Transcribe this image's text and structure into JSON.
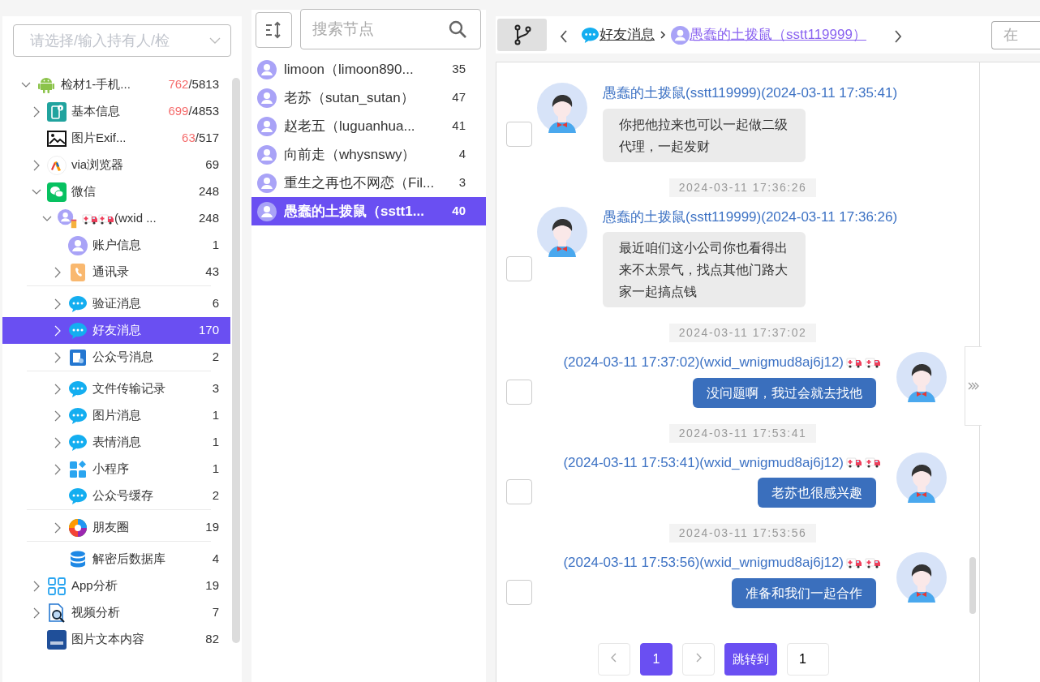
{
  "holder_select": {
    "placeholder": "请选择/输入持有人/检"
  },
  "tree": [
    {
      "label": "检材1-手机...",
      "count_red": "762",
      "count": "/5813",
      "expanded": true,
      "selected": false,
      "children": [
        {
          "label": "基本信息",
          "count_red": "699",
          "count": "/4853",
          "expanded": false,
          "selected": false
        },
        {
          "label": "图片Exif...",
          "count_red": "63",
          "count": "/517",
          "selected": false
        },
        {
          "label": "via浏览器",
          "count": "69",
          "expanded": false,
          "selected": false
        },
        {
          "label": "微信",
          "count": "248",
          "expanded": true,
          "selected": false,
          "children": [
            {
              "label": "(wxid ...",
              "count": "248",
              "expanded": true,
              "selected": false,
              "children": [
                {
                  "label": "账户信息",
                  "count": "1",
                  "selected": false,
                  "separated": false
                },
                {
                  "label": "通讯录",
                  "count": "43",
                  "expanded": false,
                  "selected": false,
                  "separated": false
                },
                {
                  "label": "验证消息",
                  "count": "6",
                  "expanded": false,
                  "selected": false,
                  "separated": true
                },
                {
                  "label": "好友消息",
                  "count": "170",
                  "expanded": false,
                  "selected": true,
                  "separated": false
                },
                {
                  "label": "公众号消息",
                  "count": "2",
                  "expanded": false,
                  "selected": false,
                  "separated": false
                },
                {
                  "label": "文件传输记录",
                  "count": "3",
                  "expanded": false,
                  "selected": false,
                  "separated": true
                },
                {
                  "label": "图片消息",
                  "count": "1",
                  "expanded": false,
                  "selected": false,
                  "separated": false
                },
                {
                  "label": "表情消息",
                  "count": "1",
                  "expanded": false,
                  "selected": false,
                  "separated": false
                },
                {
                  "label": "小程序",
                  "count": "1",
                  "expanded": false,
                  "selected": false,
                  "separated": false
                },
                {
                  "label": "公众号缓存",
                  "count": "2",
                  "selected": false,
                  "separated": false
                },
                {
                  "label": "朋友圈",
                  "count": "19",
                  "expanded": false,
                  "selected": false,
                  "separated": true
                },
                {
                  "label": "解密后数据库",
                  "count": "4",
                  "selected": false,
                  "separated": true
                }
              ]
            }
          ]
        },
        {
          "label": "App分析",
          "count": "19",
          "expanded": false,
          "selected": false
        },
        {
          "label": "视频分析",
          "count": "7",
          "expanded": false,
          "selected": false
        },
        {
          "label": "图片文本内容",
          "count": "82",
          "selected": false
        }
      ]
    }
  ],
  "node_search": {
    "placeholder": "搜索节点"
  },
  "contacts": [
    {
      "name": "limoon（limoon890...",
      "count": "35",
      "selected": false
    },
    {
      "name": "老苏（sutan_sutan）",
      "count": "47",
      "selected": false
    },
    {
      "name": "赵老五（luguanhua...",
      "count": "41",
      "selected": false
    },
    {
      "name": "向前走（whysnswy）",
      "count": "4",
      "selected": false
    },
    {
      "name": "重生之再也不网恋（Fil...",
      "count": "3",
      "selected": false
    },
    {
      "name": "愚蠢的土拨鼠（sstt1...",
      "count": "40",
      "selected": true
    }
  ],
  "breadcrumb": [
    "好友消息",
    "愚蠢的土拨鼠（sstt119999）"
  ],
  "message_search": {
    "placeholder": "在"
  },
  "messages": [
    {
      "kind": "received",
      "header": "愚蠢的土拨鼠(sstt119999)(2024-03-11 17:35:41)",
      "text": "你把他拉来也可以一起做二级代理，一起发财",
      "checked": false
    },
    {
      "kind": "received",
      "timestamp": "2024-03-11 17:36:26",
      "header": "愚蠢的土拨鼠(sstt119999)(2024-03-11 17:36:26)",
      "text": "最近咱们这小公司你也看得出来不太景气，找点其他门路大家一起搞点钱",
      "checked": false
    },
    {
      "kind": "sent",
      "timestamp": "2024-03-11 17:37:02",
      "header": "(2024-03-11 17:37:02)(wxid_wnigmud8aj6j12)",
      "text": "没问题啊，我过会就去找他",
      "checked": false
    },
    {
      "kind": "sent",
      "timestamp": "2024-03-11 17:53:41",
      "header": "(2024-03-11 17:53:41)(wxid_wnigmud8aj6j12)",
      "text": "老苏也很感兴趣",
      "checked": false
    },
    {
      "kind": "sent",
      "timestamp": "2024-03-11 17:53:56",
      "header": "(2024-03-11 17:53:56)(wxid_wnigmud8aj6j12)",
      "text": "准备和我们一起合作",
      "checked": false
    }
  ],
  "pagination": {
    "pages": [
      {
        "label": "1",
        "selected": true
      }
    ],
    "jump_label": "跳转到",
    "jump_value": "1"
  }
}
